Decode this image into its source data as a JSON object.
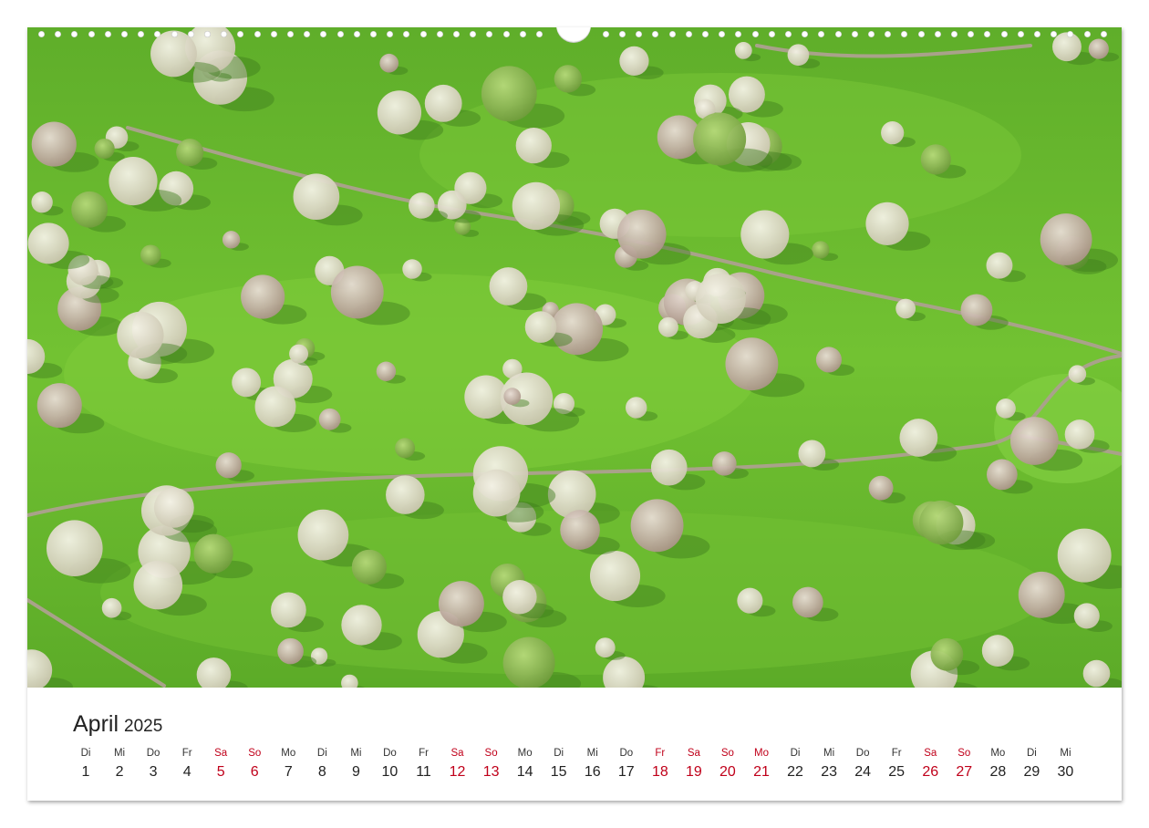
{
  "calendar": {
    "month": "April",
    "year": "2025",
    "weekend_color": "#c0001a",
    "days": [
      {
        "wd": "Di",
        "n": "1",
        "we": false
      },
      {
        "wd": "Mi",
        "n": "2",
        "we": false
      },
      {
        "wd": "Do",
        "n": "3",
        "we": false
      },
      {
        "wd": "Fr",
        "n": "4",
        "we": false
      },
      {
        "wd": "Sa",
        "n": "5",
        "we": true
      },
      {
        "wd": "So",
        "n": "6",
        "we": true
      },
      {
        "wd": "Mo",
        "n": "7",
        "we": false
      },
      {
        "wd": "Di",
        "n": "8",
        "we": false
      },
      {
        "wd": "Mi",
        "n": "9",
        "we": false
      },
      {
        "wd": "Do",
        "n": "10",
        "we": false
      },
      {
        "wd": "Fr",
        "n": "11",
        "we": false
      },
      {
        "wd": "Sa",
        "n": "12",
        "we": true
      },
      {
        "wd": "So",
        "n": "13",
        "we": true
      },
      {
        "wd": "Mo",
        "n": "14",
        "we": false
      },
      {
        "wd": "Di",
        "n": "15",
        "we": false
      },
      {
        "wd": "Mi",
        "n": "16",
        "we": false
      },
      {
        "wd": "Do",
        "n": "17",
        "we": false
      },
      {
        "wd": "Fr",
        "n": "18",
        "we": true
      },
      {
        "wd": "Sa",
        "n": "19",
        "we": true
      },
      {
        "wd": "So",
        "n": "20",
        "we": true
      },
      {
        "wd": "Mo",
        "n": "21",
        "we": true
      },
      {
        "wd": "Di",
        "n": "22",
        "we": false
      },
      {
        "wd": "Mi",
        "n": "23",
        "we": false
      },
      {
        "wd": "Do",
        "n": "24",
        "we": false
      },
      {
        "wd": "Fr",
        "n": "25",
        "we": false
      },
      {
        "wd": "Sa",
        "n": "26",
        "we": true
      },
      {
        "wd": "So",
        "n": "27",
        "we": true
      },
      {
        "wd": "Mo",
        "n": "28",
        "we": false
      },
      {
        "wd": "Di",
        "n": "29",
        "we": false
      },
      {
        "wd": "Mi",
        "n": "30",
        "we": false
      }
    ]
  }
}
